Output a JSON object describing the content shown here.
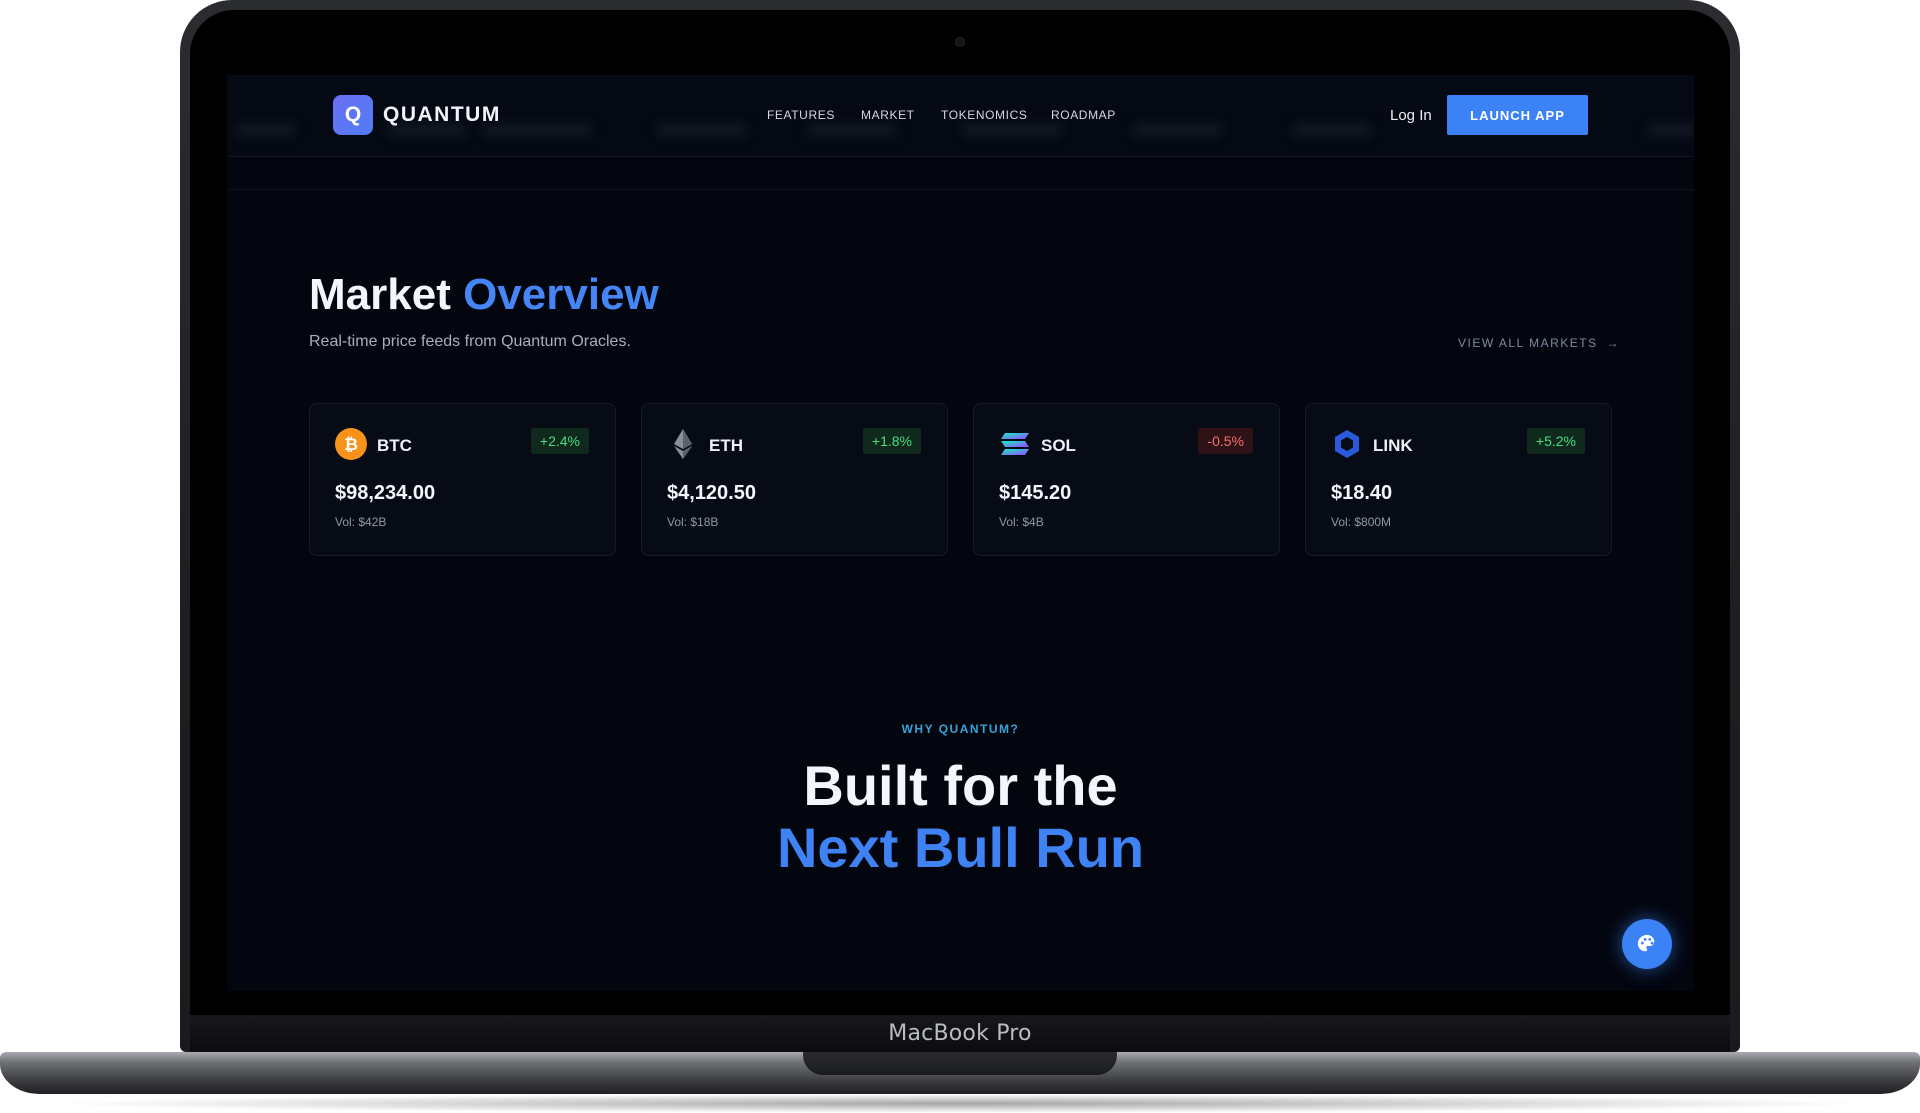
{
  "device": {
    "label": "MacBook Pro"
  },
  "nav": {
    "brand_letter": "Q",
    "brand_name": "QUANTUM",
    "links": [
      "FEATURES",
      "MARKET",
      "TOKENOMICS",
      "ROADMAP"
    ],
    "login_label": "Log In",
    "launch_label": "LAUNCH APP"
  },
  "market": {
    "title_main": "Market",
    "title_accent": "Overview",
    "subtitle": "Real-time price feeds from Quantum Oracles.",
    "view_all_label": "VIEW ALL MARKETS",
    "view_all_arrow": "→",
    "cards": [
      {
        "symbol": "BTC",
        "change": "+2.4%",
        "trend": "up",
        "price": "$98,234.00",
        "volume": "Vol: $42B",
        "icon": "bitcoin-icon"
      },
      {
        "symbol": "ETH",
        "change": "+1.8%",
        "trend": "up",
        "price": "$4,120.50",
        "volume": "Vol: $18B",
        "icon": "ethereum-icon"
      },
      {
        "symbol": "SOL",
        "change": "-0.5%",
        "trend": "down",
        "price": "$145.20",
        "volume": "Vol: $4B",
        "icon": "solana-icon"
      },
      {
        "symbol": "LINK",
        "change": "+5.2%",
        "trend": "up",
        "price": "$18.40",
        "volume": "Vol: $800M",
        "icon": "chainlink-icon"
      }
    ]
  },
  "why": {
    "eyebrow": "WHY QUANTUM?",
    "headline_line1": "Built for the",
    "headline_line2": "Next Bull Run"
  },
  "fab": {
    "icon": "palette-icon"
  },
  "colors": {
    "accent": "#3b82f6",
    "background": "#03060f",
    "positive": "#4ade80",
    "negative": "#f87171",
    "eyebrow": "#38a3d6"
  }
}
